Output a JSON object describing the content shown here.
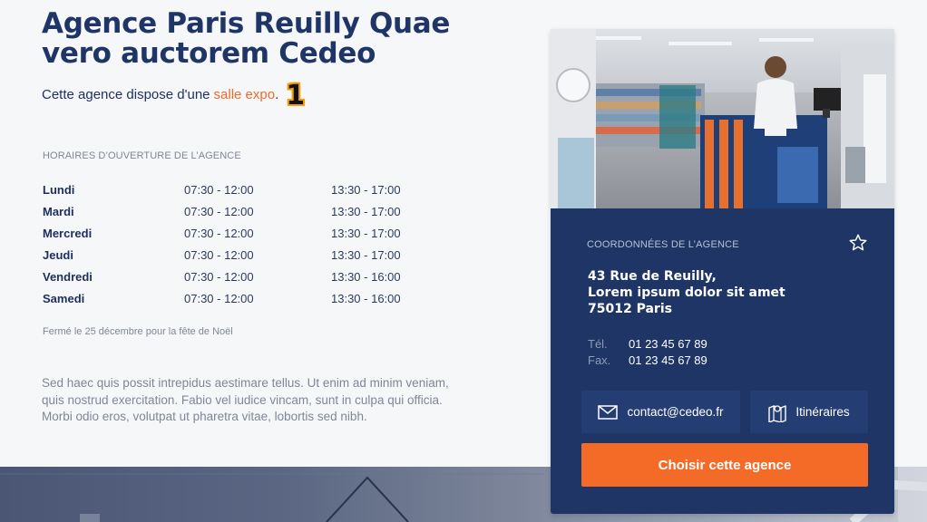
{
  "agency": {
    "title": "Agence Paris Reuilly Quae vero auctorem Cedeo",
    "intro_text": "Cette agence dispose d'une",
    "intro_link": "salle expo",
    "intro_end": ".",
    "badge": "1"
  },
  "hours": {
    "heading": "HORAIRES D’OUVERTURE DE L’AGENCE",
    "rows": [
      {
        "day": "Lundi",
        "am": "07:30 - 12:00",
        "pm": "13:30 - 17:00"
      },
      {
        "day": "Mardi",
        "am": "07:30 - 12:00",
        "pm": "13:30 - 17:00"
      },
      {
        "day": "Mercredi",
        "am": "07:30 - 12:00",
        "pm": "13:30 - 17:00"
      },
      {
        "day": "Jeudi",
        "am": "07:30 - 12:00",
        "pm": "13:30 - 17:00"
      },
      {
        "day": "Vendredi",
        "am": "07:30 - 12:00",
        "pm": "13:30 - 16:00"
      },
      {
        "day": "Samedi",
        "am": "07:30 - 12:00",
        "pm": "13:30 - 16:00"
      }
    ],
    "closed_note": "Fermé le 25 décembre pour la fête de Noël"
  },
  "description": "Sed haec quis possit intrepidus aestimare tellus. Ut enim ad minim veniam, quis nostrud exercitation. Fabio vel iudice vincam, sunt in culpa qui officia. Morbi odio eros, volutpat ut pharetra vitae, lobortis sed nibh.",
  "card": {
    "heading": "COORDONNÉES DE L’AGENCE",
    "address": [
      "43 Rue de Reuilly,",
      "Lorem ipsum dolor sit amet",
      "75012 Paris"
    ],
    "tel_label": "Tél.",
    "tel": "01 23 45 67 89",
    "fax_label": "Fax.",
    "fax": "01 23 45 67 89",
    "email_button": "contact@cedeo.fr",
    "route_button": "Itinéraires",
    "choose_button": "Choisir cette agence",
    "icons": {
      "favorite": "star-icon",
      "email": "envelope-icon",
      "route": "map-icon"
    }
  },
  "colors": {
    "navy": "#1e3566",
    "title": "#1f3567",
    "accent": "#f46a27",
    "link": "#f26a2a",
    "muted": "#7f8696"
  }
}
